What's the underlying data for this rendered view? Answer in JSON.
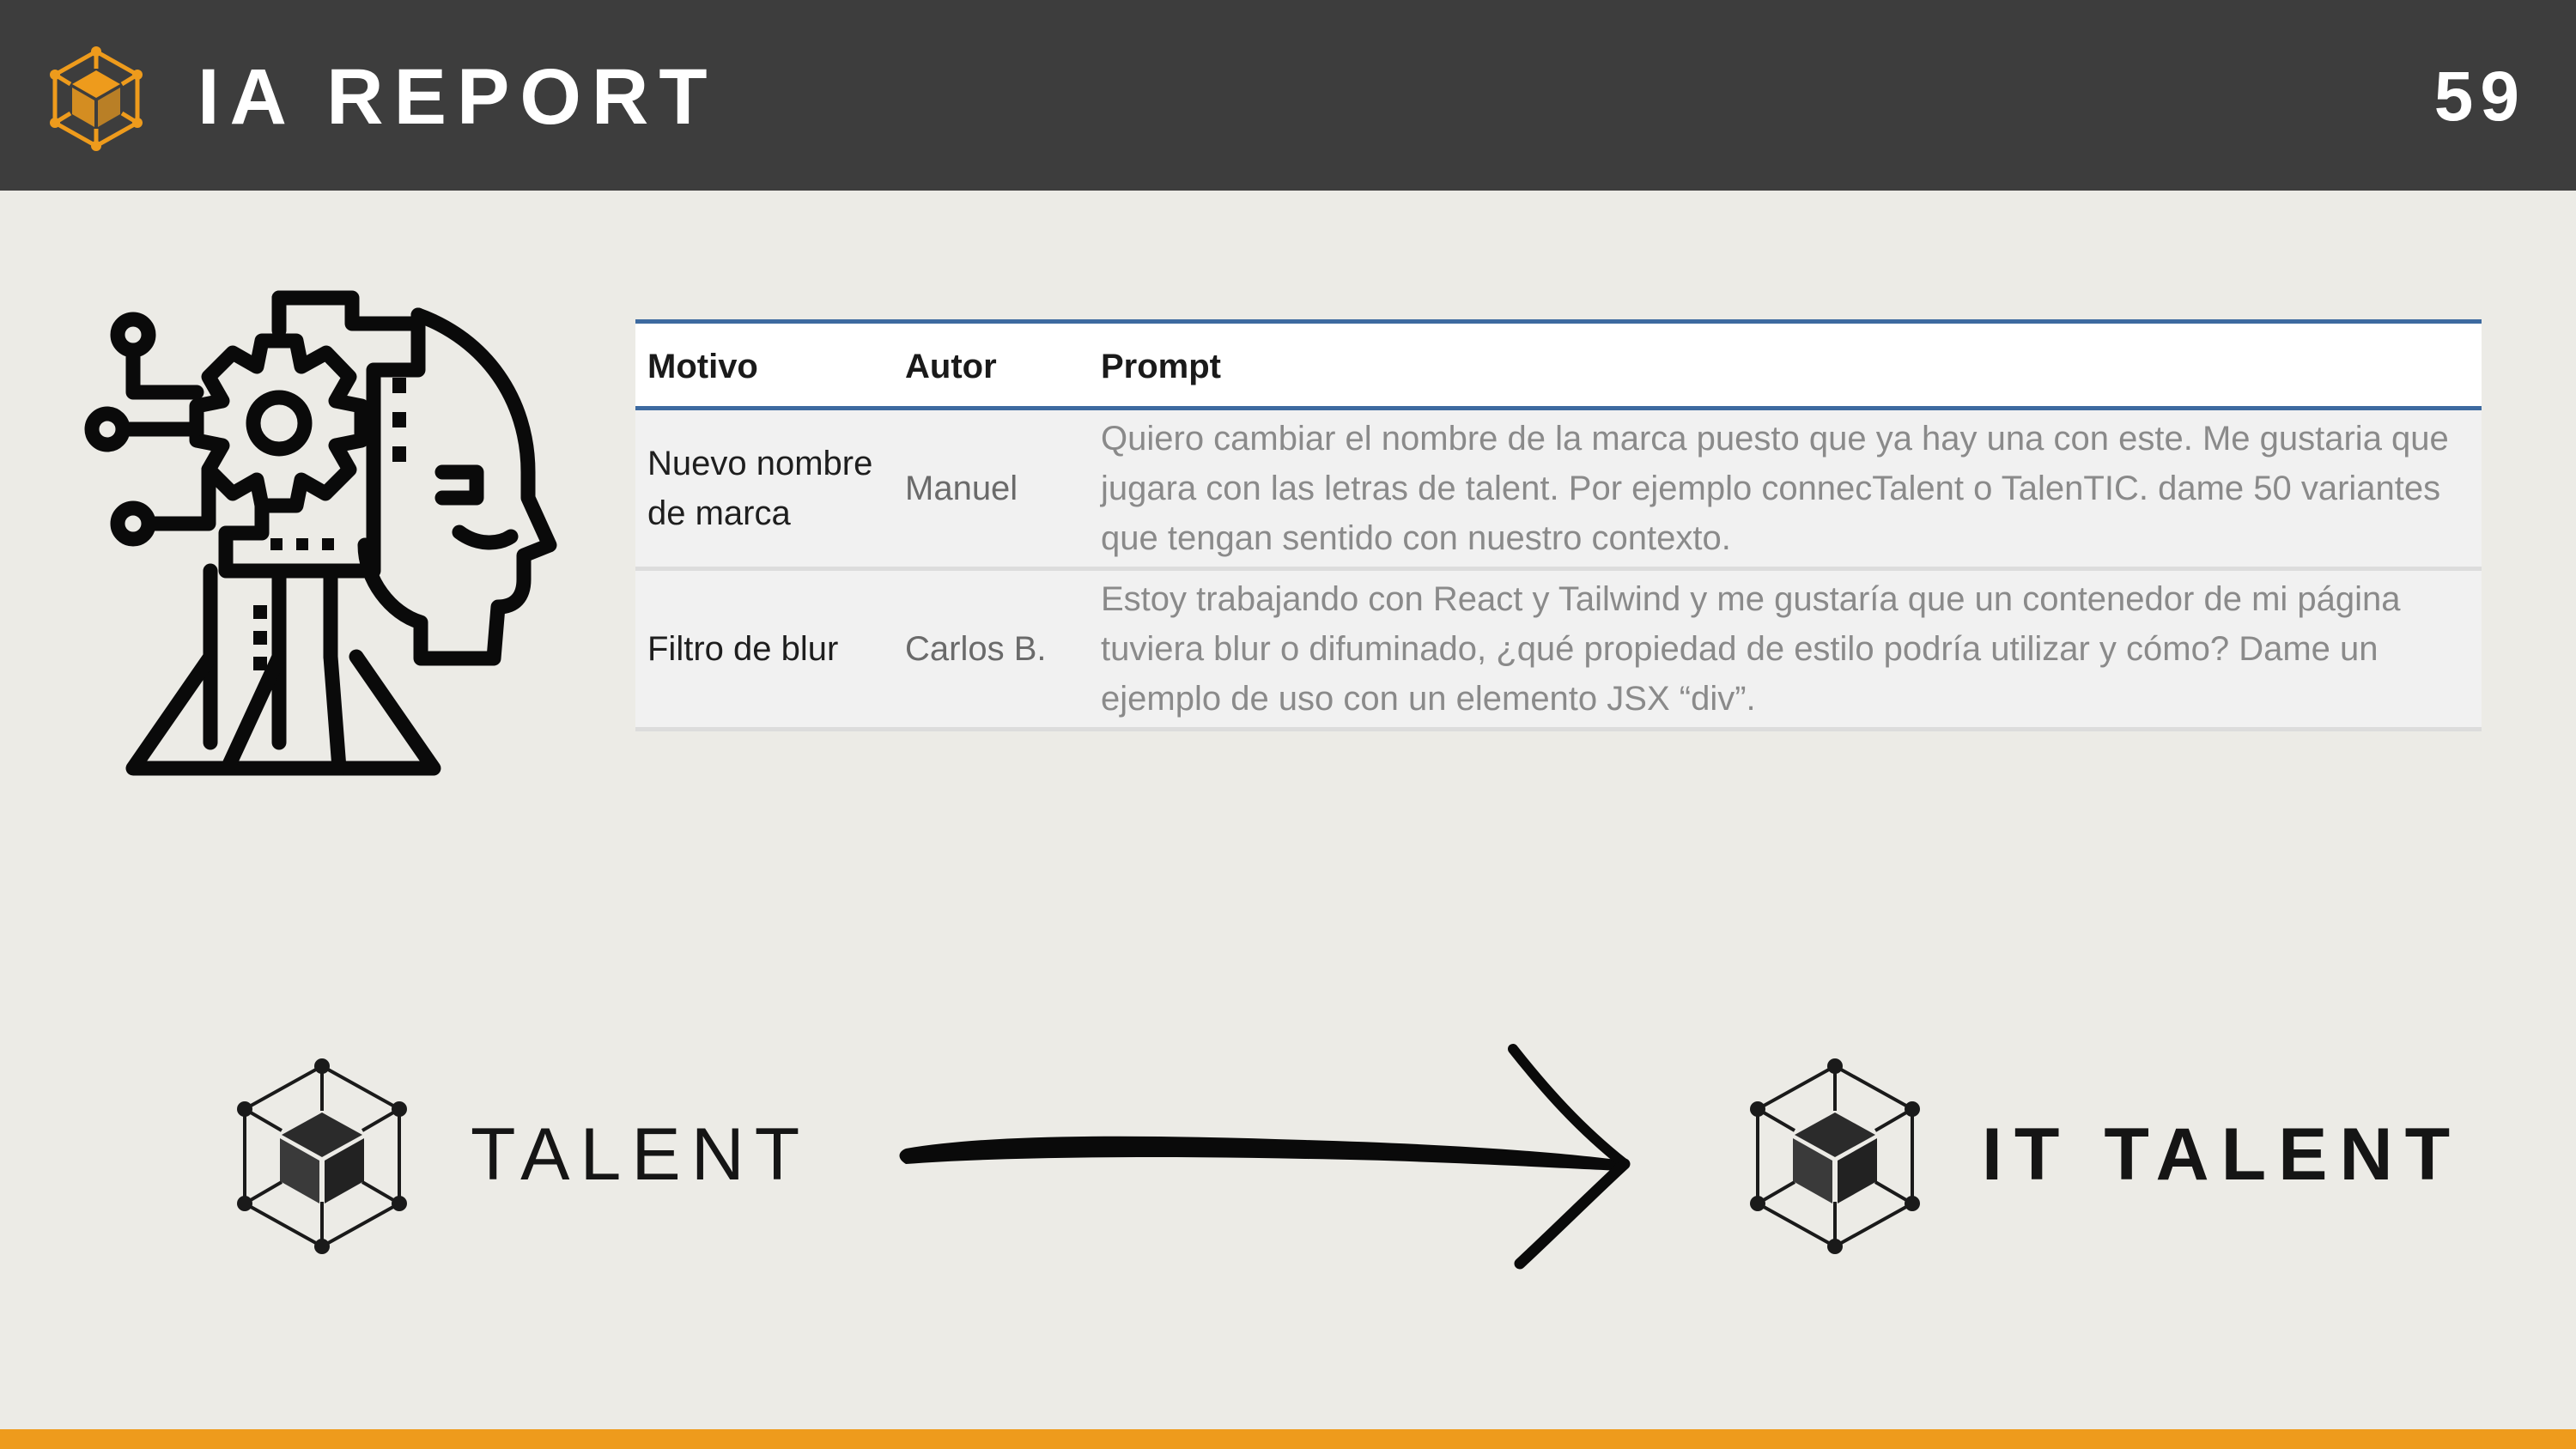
{
  "header": {
    "title": "IA REPORT",
    "page_number": "59",
    "logo_icon": "cube-network-logo-icon"
  },
  "colors": {
    "header_background": "#3d3d3d",
    "page_background": "#ecebe6",
    "accent_orange": "#ee9b1c",
    "table_rule_blue": "#3d6aa0"
  },
  "illustration": {
    "icon": "ai-head-gear-circuit-icon"
  },
  "table": {
    "headers": {
      "motivo": "Motivo",
      "autor": "Autor",
      "prompt": "Prompt"
    },
    "rows": [
      {
        "motivo": "Nuevo nombre de marca",
        "autor": "Manuel",
        "prompt": "Quiero cambiar el nombre de la marca puesto que ya hay una con este. Me gustaria que jugara con las letras de talent. Por ejemplo connecTalent o TalenTIC. dame 50 variantes que tengan sentido con nuestro contexto."
      },
      {
        "motivo": "Filtro de blur",
        "autor": "Carlos B.",
        "prompt": "Estoy trabajando con React y Tailwind y me gustaría que un contenedor de mi página tuviera blur o difuminado, ¿qué propiedad de estilo podría utilizar y cómo? Dame un ejemplo de uso con un elemento JSX “div”."
      }
    ]
  },
  "rename": {
    "from_label": "TALENT",
    "to_label": "IT TALENT",
    "from_icon": "cube-network-icon",
    "to_icon": "cube-network-icon",
    "arrow_icon": "hand-drawn-arrow-right-icon"
  }
}
